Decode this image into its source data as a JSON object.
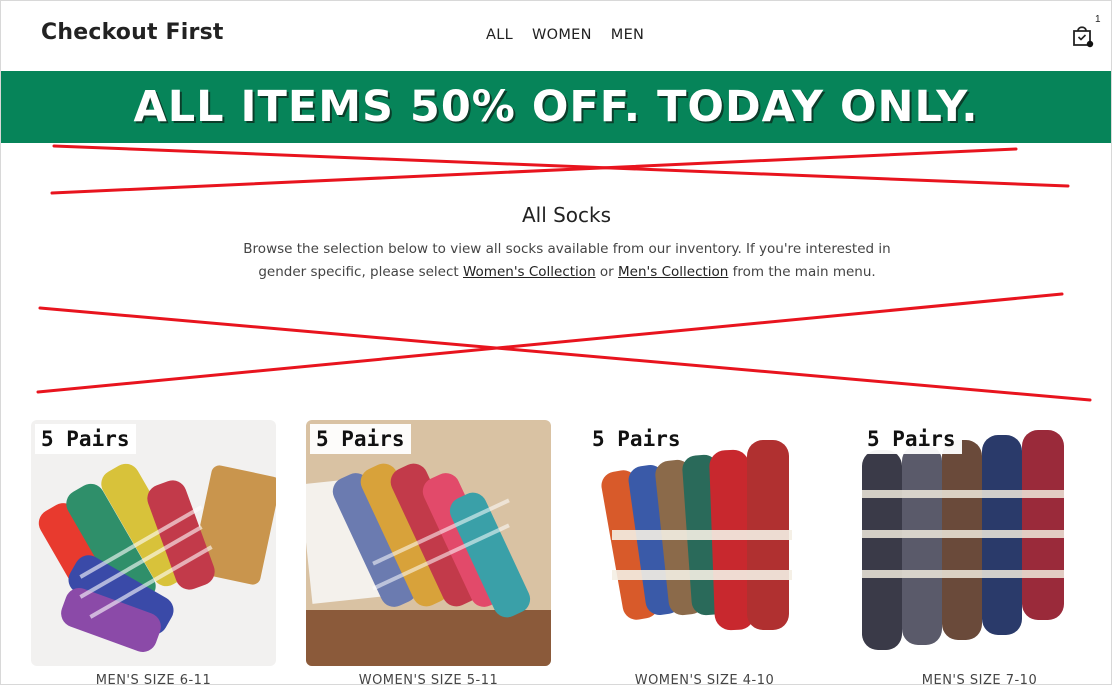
{
  "header": {
    "brand": "Checkout First",
    "nav": [
      "ALL",
      "WOMEN",
      "MEN"
    ],
    "cart_count": "1"
  },
  "banner": {
    "text": "ALL ITEMS 50% OFF. TODAY ONLY."
  },
  "main": {
    "title": "All Socks",
    "desc_part1": "Browse the selection below to view all socks available from our inventory. If you're interested in gender specific, please select ",
    "link_women": "Women's Collection",
    "desc_part2": " or ",
    "link_men": "Men's Collection",
    "desc_part3": " from the main menu."
  },
  "products": [
    {
      "badge": "5 Pairs",
      "caption": "MEN'S SIZE 6-11"
    },
    {
      "badge": "5 Pairs",
      "caption": "WOMEN'S SIZE 5-11"
    },
    {
      "badge": "5 Pairs",
      "caption": "WOMEN'S SIZE 4-10"
    },
    {
      "badge": "5 Pairs",
      "caption": "MEN'S SIZE 7-10"
    }
  ],
  "colors": {
    "banner": "#068459",
    "scribble": "#e8141e"
  }
}
